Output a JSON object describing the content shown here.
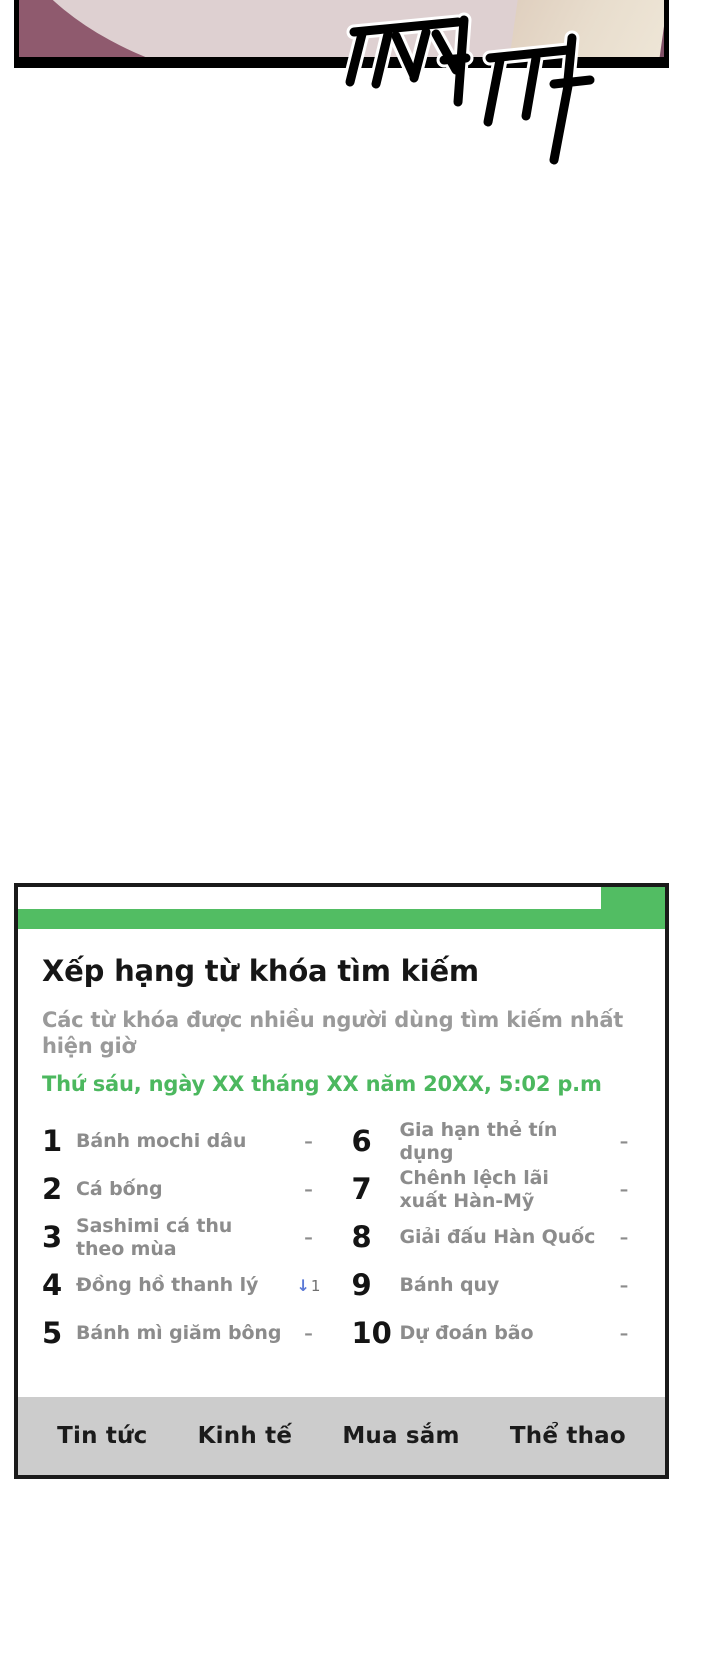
{
  "comic": {
    "sfx_text": "쩌쩌쩌쩌",
    "sfx_label": "korean-sound-effect",
    "panel_label": "webtoon-panel"
  },
  "card": {
    "title": "Xếp hạng từ khóa tìm kiếm",
    "subtitle": "Các từ khóa được nhiều người dùng tìm kiếm nhất hiện giờ",
    "date": "Thứ sáu, ngày XX tháng XX năm 20XX, 5:02 p.m",
    "accent_color": "#52bd63",
    "date_color": "#4cb85f",
    "footer_bg": "#cccccc"
  },
  "rankings": {
    "left": [
      {
        "rank": "1",
        "keyword": "Bánh mochi dâu",
        "delta": "–",
        "delta_type": "none"
      },
      {
        "rank": "2",
        "keyword": "Cá bống",
        "delta": "–",
        "delta_type": "none"
      },
      {
        "rank": "3",
        "keyword": "Sashimi cá thu theo mùa",
        "delta": "–",
        "delta_type": "none"
      },
      {
        "rank": "4",
        "keyword": "Đồng hồ thanh lý",
        "delta": "1",
        "delta_type": "down",
        "arrow": "↓"
      },
      {
        "rank": "5",
        "keyword": "Bánh mì giăm bông",
        "delta": "–",
        "delta_type": "none"
      }
    ],
    "right": [
      {
        "rank": "6",
        "keyword": "Gia hạn thẻ tín dụng",
        "delta": "–",
        "delta_type": "none"
      },
      {
        "rank": "7",
        "keyword": "Chênh lệch lãi xuất Hàn-Mỹ",
        "delta": "–",
        "delta_type": "none"
      },
      {
        "rank": "8",
        "keyword": "Giải đấu Hàn Quốc",
        "delta": "–",
        "delta_type": "none"
      },
      {
        "rank": "9",
        "keyword": "Bánh quy",
        "delta": "–",
        "delta_type": "none"
      },
      {
        "rank": "10",
        "keyword": "Dự đoán bão",
        "delta": "–",
        "delta_type": "none"
      }
    ]
  },
  "footer_tabs": [
    {
      "label": "Tin tức"
    },
    {
      "label": "Kinh tế"
    },
    {
      "label": "Mua sắm"
    },
    {
      "label": "Thể thao"
    }
  ]
}
